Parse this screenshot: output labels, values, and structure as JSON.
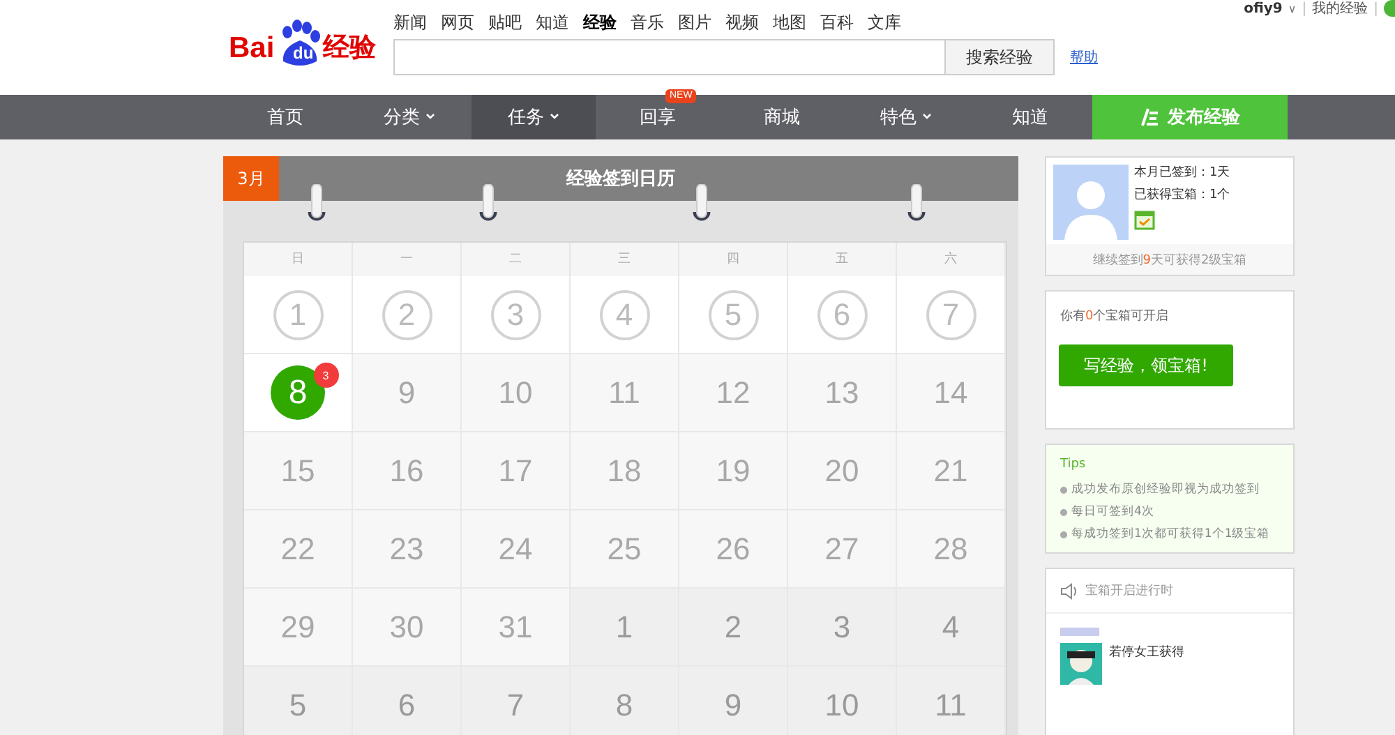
{
  "logo": {
    "left": "Bai",
    "mark": "du",
    "right": "经验"
  },
  "top_links": [
    {
      "label": "新闻",
      "selected": false
    },
    {
      "label": "网页",
      "selected": false
    },
    {
      "label": "贴吧",
      "selected": false
    },
    {
      "label": "知道",
      "selected": false
    },
    {
      "label": "经验",
      "selected": true
    },
    {
      "label": "音乐",
      "selected": false
    },
    {
      "label": "图片",
      "selected": false
    },
    {
      "label": "视频",
      "selected": false
    },
    {
      "label": "地图",
      "selected": false
    },
    {
      "label": "百科",
      "selected": false
    },
    {
      "label": "文库",
      "selected": false
    }
  ],
  "search": {
    "button": "搜索经验",
    "help": "帮助"
  },
  "user_bar": {
    "username": "ofiy9",
    "caret": "∨",
    "separators": [
      "|",
      "|"
    ],
    "my_link": "我的经验"
  },
  "nav": [
    {
      "label": "首页",
      "dropdown": false,
      "selected": false
    },
    {
      "label": "分类",
      "dropdown": true,
      "selected": false
    },
    {
      "label": "任务",
      "dropdown": true,
      "selected": true
    },
    {
      "label": "回享",
      "dropdown": false,
      "selected": false,
      "badge": "NEW"
    },
    {
      "label": "商城",
      "dropdown": false,
      "selected": false
    },
    {
      "label": "特色",
      "dropdown": true,
      "selected": false
    },
    {
      "label": "知道",
      "dropdown": false,
      "selected": false
    }
  ],
  "publish_button": "发布经验",
  "calendar": {
    "month": "3月",
    "title": "经验签到日历",
    "weekdays": [
      "日",
      "一",
      "二",
      "三",
      "四",
      "五",
      "六"
    ],
    "days": [
      {
        "day": "1",
        "kind": "past"
      },
      {
        "day": "2",
        "kind": "past"
      },
      {
        "day": "3",
        "kind": "past"
      },
      {
        "day": "4",
        "kind": "past"
      },
      {
        "day": "5",
        "kind": "past"
      },
      {
        "day": "6",
        "kind": "past"
      },
      {
        "day": "7",
        "kind": "past"
      },
      {
        "day": "8",
        "kind": "today",
        "badge": "3"
      },
      {
        "day": "9",
        "kind": "future"
      },
      {
        "day": "10",
        "kind": "future"
      },
      {
        "day": "11",
        "kind": "future"
      },
      {
        "day": "12",
        "kind": "future"
      },
      {
        "day": "13",
        "kind": "future"
      },
      {
        "day": "14",
        "kind": "future"
      },
      {
        "day": "15",
        "kind": "future"
      },
      {
        "day": "16",
        "kind": "future"
      },
      {
        "day": "17",
        "kind": "future"
      },
      {
        "day": "18",
        "kind": "future"
      },
      {
        "day": "19",
        "kind": "future"
      },
      {
        "day": "20",
        "kind": "future"
      },
      {
        "day": "21",
        "kind": "future"
      },
      {
        "day": "22",
        "kind": "future"
      },
      {
        "day": "23",
        "kind": "future"
      },
      {
        "day": "24",
        "kind": "future"
      },
      {
        "day": "25",
        "kind": "future"
      },
      {
        "day": "26",
        "kind": "future"
      },
      {
        "day": "27",
        "kind": "future"
      },
      {
        "day": "28",
        "kind": "future"
      },
      {
        "day": "29",
        "kind": "future"
      },
      {
        "day": "30",
        "kind": "future"
      },
      {
        "day": "31",
        "kind": "future"
      },
      {
        "day": "1",
        "kind": "next"
      },
      {
        "day": "2",
        "kind": "next"
      },
      {
        "day": "3",
        "kind": "next"
      },
      {
        "day": "4",
        "kind": "next"
      },
      {
        "day": "5",
        "kind": "next"
      },
      {
        "day": "6",
        "kind": "next"
      },
      {
        "day": "7",
        "kind": "next"
      },
      {
        "day": "8",
        "kind": "next"
      },
      {
        "day": "9",
        "kind": "next"
      },
      {
        "day": "10",
        "kind": "next"
      },
      {
        "day": "11",
        "kind": "next"
      }
    ]
  },
  "profile": {
    "signed": "本月已签到：1天",
    "boxes": "已获得宝箱：1个",
    "note": {
      "before": "继续签到",
      "count": "9",
      "after": "天可获得2级宝箱"
    }
  },
  "chest": {
    "text": {
      "before": "你有",
      "count": "0",
      "after": "个宝箱可开启"
    },
    "button": "写经验，领宝箱!"
  },
  "tips": {
    "title": "Tips",
    "items": [
      "成功发布原创经验即视为成功签到",
      "每日可签到4次",
      "每成功签到1次都可获得1个1级宝箱"
    ]
  },
  "feed": {
    "title": "宝箱开启进行时",
    "items": [
      {
        "text": "若停女王获得",
        "kind": "picture"
      }
    ]
  }
}
